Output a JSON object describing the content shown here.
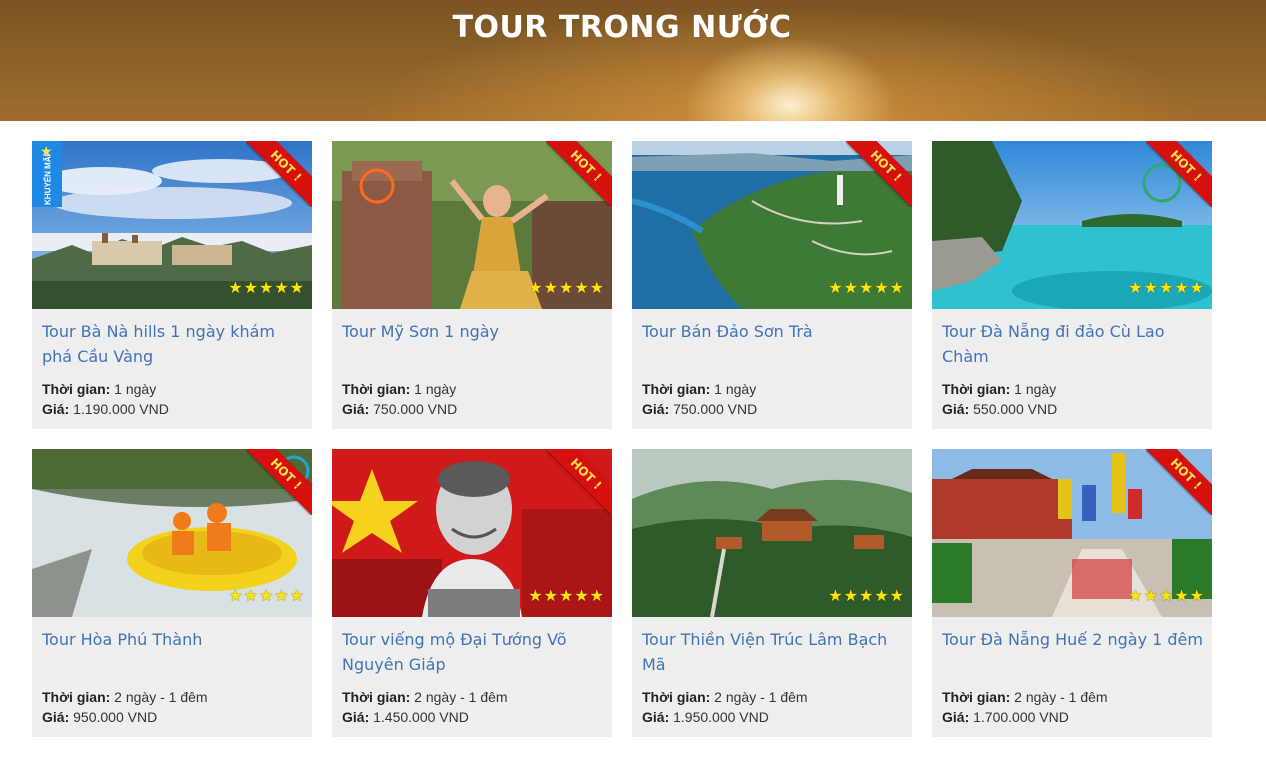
{
  "header": {
    "title": "TOUR TRONG NƯỚC"
  },
  "labels": {
    "duration": "Thời gian:",
    "price": "Giá:",
    "hot": "HOT !",
    "promo": "KHUYẾN MÃI",
    "rating_icon": "star-icon"
  },
  "tours": [
    {
      "title": "Tour Bà Nà hills 1 ngày khám phá Cầu Vàng",
      "duration": "1 ngày",
      "price": "1.190.000 VND",
      "hot": true,
      "promo": true,
      "rating": 5
    },
    {
      "title": "Tour Mỹ Sơn 1 ngày",
      "duration": "1 ngày",
      "price": "750.000 VND",
      "hot": true,
      "promo": false,
      "rating": 5
    },
    {
      "title": "Tour Bán Đảo Sơn Trà",
      "duration": "1 ngày",
      "price": "750.000 VND",
      "hot": true,
      "promo": false,
      "rating": 5
    },
    {
      "title": "Tour Đà Nẵng đi đảo Cù Lao Chàm",
      "duration": "1 ngày",
      "price": "550.000 VND",
      "hot": true,
      "promo": false,
      "rating": 5
    },
    {
      "title": "Tour Hòa Phú Thành",
      "duration": "2 ngày - 1 đêm",
      "price": "950.000 VND",
      "hot": true,
      "promo": false,
      "rating": 5
    },
    {
      "title": "Tour viếng mộ Đại Tướng Võ Nguyên Giáp",
      "duration": "2 ngày - 1 đêm",
      "price": "1.450.000 VND",
      "hot": true,
      "promo": false,
      "rating": 5
    },
    {
      "title": "Tour Thiền Viện Trúc Lâm Bạch Mã",
      "duration": "2 ngày - 1 đêm",
      "price": "1.950.000 VND",
      "hot": false,
      "promo": false,
      "rating": 5
    },
    {
      "title": "Tour Đà Nẵng Huế 2 ngày 1 đêm",
      "duration": "2 ngày - 1 đêm",
      "price": "1.700.000 VND",
      "hot": true,
      "promo": false,
      "rating": 5
    }
  ]
}
